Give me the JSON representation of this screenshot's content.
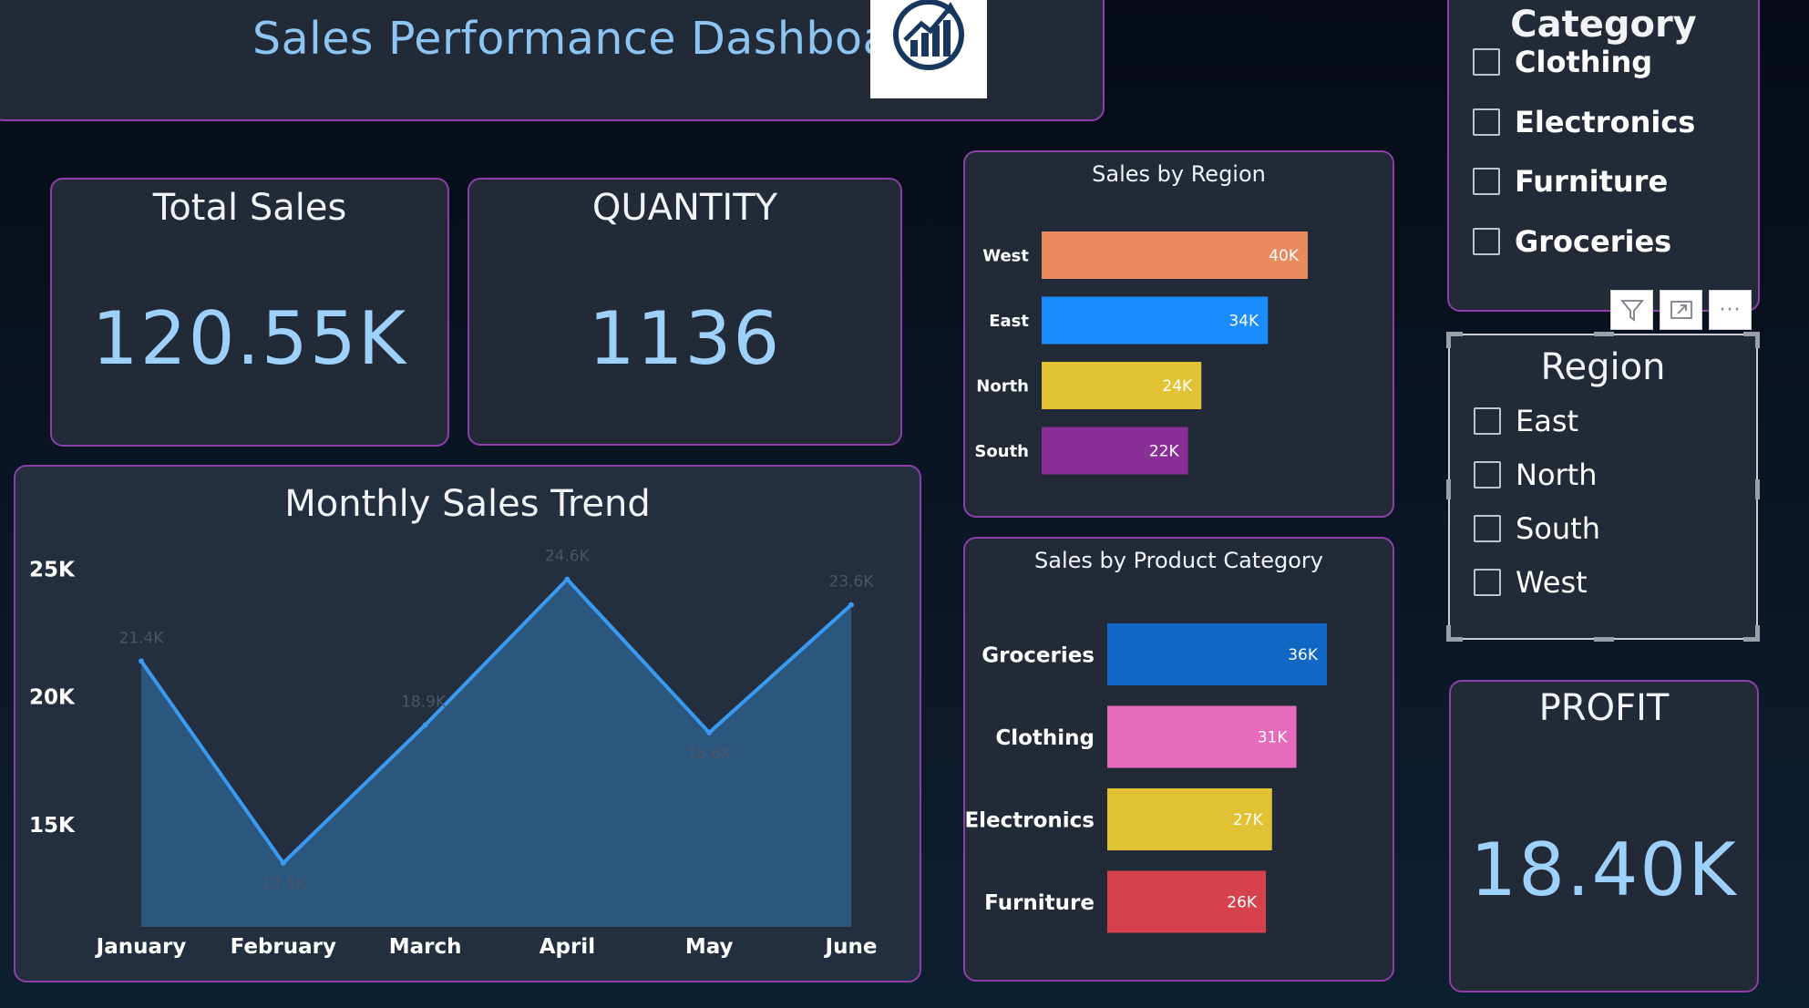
{
  "header": {
    "title": "Sales Performance Dashboard",
    "logo_icon": "growth-chart-logo"
  },
  "kpis": {
    "total_sales": {
      "label": "Total Sales",
      "value": "120.55K"
    },
    "quantity": {
      "label": "QUANTITY",
      "value": "1136"
    },
    "profit": {
      "label": "PROFIT",
      "value": "18.40K"
    }
  },
  "trend": {
    "title": "Monthly Sales Trend",
    "y_ticks": [
      "25K",
      "20K",
      "15K"
    ],
    "months": [
      "January",
      "February",
      "March",
      "April",
      "May",
      "June"
    ],
    "data_labels": [
      "21.4K",
      "13.5K",
      "18.9K",
      "24.6K",
      "18.6K",
      "23.6K"
    ]
  },
  "region_chart": {
    "title": "Sales by Region",
    "categories": [
      "West",
      "East",
      "North",
      "South"
    ],
    "labels": [
      "40K",
      "34K",
      "24K",
      "22K"
    ]
  },
  "category_chart": {
    "title": "Sales by Product Category",
    "categories": [
      "Groceries",
      "Clothing",
      "Electronics",
      "Furniture"
    ],
    "labels": [
      "36K",
      "31K",
      "27K",
      "26K"
    ]
  },
  "slicers": {
    "category": {
      "title": "Category",
      "items": [
        "Clothing",
        "Electronics",
        "Furniture",
        "Groceries"
      ]
    },
    "region": {
      "title": "Region",
      "items": [
        "East",
        "North",
        "South",
        "West"
      ]
    }
  },
  "toolbar": {
    "icons": [
      "filter-icon",
      "focus-mode-icon",
      "more-options-icon"
    ],
    "more_glyph": "···"
  },
  "colors": {
    "accent_border": "#8c3fa6",
    "kpi_value": "#9dd0fb",
    "line": "#3a9af0",
    "area": "#2c5b85",
    "west": "#ea8a5e",
    "east": "#1a8cff",
    "north": "#e0c232",
    "south": "#8a2f98",
    "groceries": "#1266c4",
    "clothing": "#e66bbd",
    "electronics": "#e0c232",
    "furniture": "#d5424e"
  },
  "chart_data": [
    {
      "type": "area",
      "title": "Monthly Sales Trend",
      "x": [
        "January",
        "February",
        "March",
        "April",
        "May",
        "June"
      ],
      "values": [
        21400,
        13500,
        18900,
        24600,
        18600,
        23600
      ],
      "y_ticks": [
        15000,
        20000,
        25000
      ],
      "ylim": [
        11000,
        25800
      ],
      "grid": false
    },
    {
      "type": "bar",
      "orientation": "horizontal",
      "title": "Sales by Region",
      "categories": [
        "West",
        "East",
        "North",
        "South"
      ],
      "values": [
        40000,
        34000,
        24000,
        22000
      ],
      "xlim": [
        0,
        40000
      ]
    },
    {
      "type": "bar",
      "orientation": "horizontal",
      "title": "Sales by Product Category",
      "categories": [
        "Groceries",
        "Clothing",
        "Electronics",
        "Furniture"
      ],
      "values": [
        36000,
        31000,
        27000,
        26000
      ],
      "xlim": [
        0,
        36000
      ]
    }
  ]
}
